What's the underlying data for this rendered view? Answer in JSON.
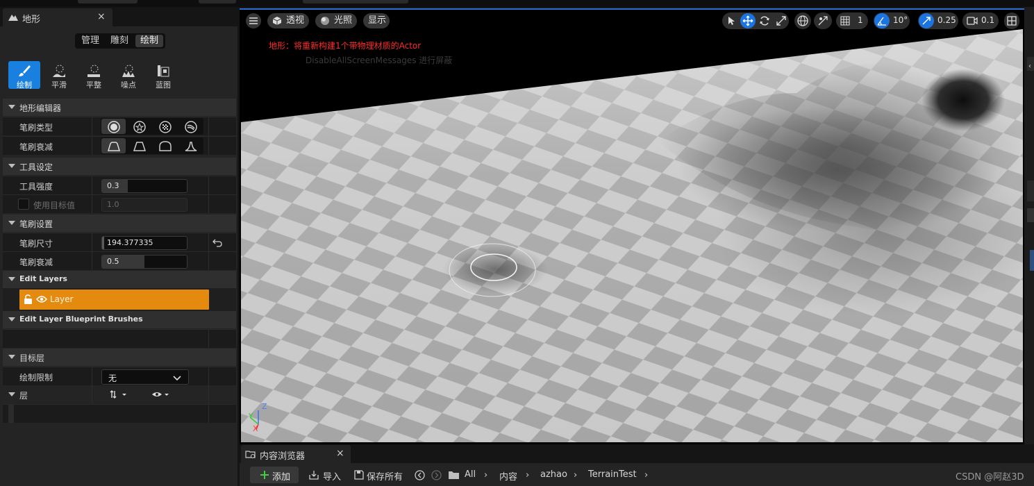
{
  "panel": {
    "tab_title": "地形",
    "close_glyph": "×",
    "modes": [
      "管理",
      "雕刻",
      "绘制"
    ],
    "active_mode": "绘制",
    "tools": [
      "绘制",
      "平滑",
      "平整",
      "噪点",
      "蓝图"
    ],
    "active_tool": "绘制",
    "sections": {
      "terrain_editor": "地形编辑器",
      "tool_settings": "工具设定",
      "brush_settings": "笔刷设置",
      "edit_layers": "Edit Layers",
      "edit_layer_blueprint_brushes": "Edit Layer Blueprint Brushes",
      "target_layer": "目标层"
    },
    "brush_type_label": "笔刷类型",
    "brush_falloff_type_label": "笔刷衰减",
    "tool_strength_label": "工具强度",
    "tool_strength_value": "0.3",
    "tool_strength_level": 0.3,
    "use_target_label": "使用目标值",
    "use_target_value": "1.0",
    "brush_size_label": "笔刷尺寸",
    "brush_size_value": "194.377335",
    "brush_falloff_label": "笔刷衰减",
    "brush_falloff_value": "0.5",
    "brush_falloff_level": 0.5,
    "layer_name": "Layer",
    "paint_restriction_label": "绘制限制",
    "paint_restriction_value": "无",
    "layers_label": "层"
  },
  "viewport": {
    "menu_icon": "hamburger-icon",
    "perspective_label": "透视",
    "lighting_label": "光照",
    "show_label": "显示",
    "grid_snap_value": "1",
    "rotation_snap_value": "10°",
    "scale_snap_value": "0.25",
    "camera_speed_value": "0.1",
    "message_line1": "地形：将重新构建1个带物理材质的Actor",
    "message_line2": "DisableAllScreenMessages 进行屏蔽",
    "axis_x": "X",
    "axis_y": "Y",
    "axis_z": "Z"
  },
  "content_browser": {
    "tab_title": "内容浏览器",
    "close_glyph": "×",
    "add_label": "添加",
    "import_label": "导入",
    "save_all_label": "保存所有",
    "breadcrumbs": [
      "All",
      "内容",
      "azhao",
      "TerrainTest"
    ]
  },
  "watermark": "CSDN @阿赵3D",
  "colors": {
    "accent_blue": "#1b74e0",
    "layer_orange": "#e38a0f",
    "message_red": "#ff2a2a"
  }
}
